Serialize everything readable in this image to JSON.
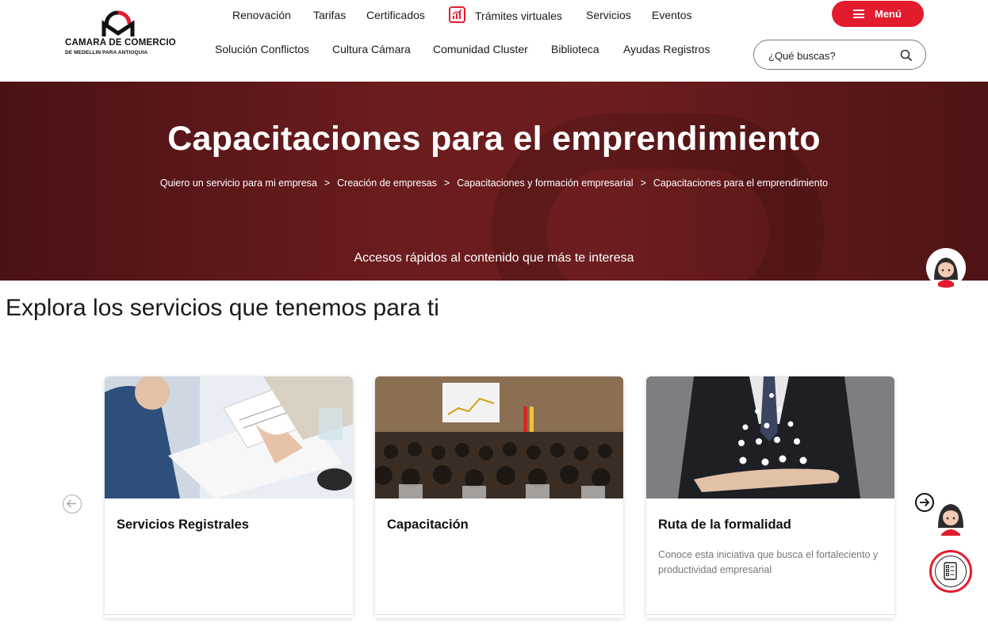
{
  "header": {
    "logo": {
      "line1": "CAMARA DE COMERCIO",
      "line2": "DE MEDELLIN PARA ANTIOQUIA"
    },
    "nav_row1": [
      "Renovación",
      "Tarifas",
      "Certificados",
      "Trámites virtuales",
      "Servicios",
      "Eventos"
    ],
    "nav_row2": [
      "Solución Conflictos",
      "Cultura Cámara",
      "Comunidad Cluster",
      "Biblioteca",
      "Ayudas Registros"
    ],
    "menu_label": "Menú",
    "search_placeholder": "¿Qué buscas?"
  },
  "hero": {
    "title": "Capacitaciones para el emprendimiento",
    "breadcrumb": [
      "Quiero un servicio para mi empresa",
      "Creación de empresas",
      "Capacitaciones y formación empresarial",
      "Capacitaciones para el emprendimiento"
    ],
    "breadcrumb_separator": ">",
    "quick_access": "Accesos rápidos al contenido que más te interesa"
  },
  "main": {
    "section_title": "Explora los servicios que tenemos para ti",
    "cards": [
      {
        "title": "Servicios Registrales",
        "description": ""
      },
      {
        "title": "Capacitación",
        "description": ""
      },
      {
        "title": "Ruta de la formalidad",
        "description": "Conoce esta iniciativa que busca el fortaleciento y productividad empresarial"
      }
    ]
  },
  "colors": {
    "brand_red": "#e31c2d",
    "hero_bg": "#6b1c1e"
  },
  "icons": {
    "tramites": "chart-icon",
    "menu": "hamburger-icon",
    "search": "search-icon",
    "carousel_prev": "arrow-left-icon",
    "carousel_next": "arrow-right-icon",
    "assistant": "assistant-avatar-icon",
    "checklist": "checklist-icon"
  }
}
